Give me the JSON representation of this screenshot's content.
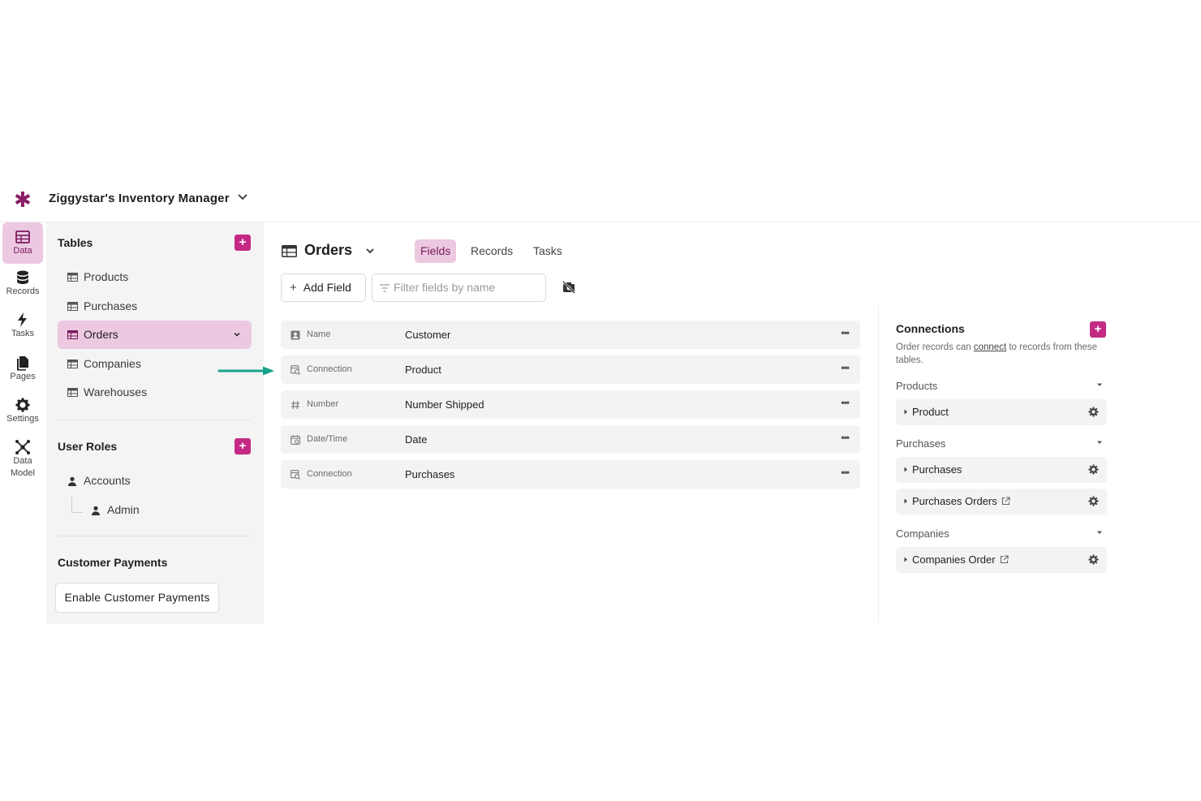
{
  "app": {
    "logo": "✱",
    "title": "Ziggystar's Inventory Manager"
  },
  "rail": [
    {
      "label": "Data",
      "icon": "data-table-icon",
      "active": true
    },
    {
      "label": "Records",
      "icon": "database-icon"
    },
    {
      "label": "Tasks",
      "icon": "lightning-icon"
    },
    {
      "label": "Pages",
      "icon": "pages-icon"
    },
    {
      "label": "Settings",
      "icon": "gear-icon"
    },
    {
      "label_line1": "Data",
      "label_line2": "Model",
      "icon": "data-model-icon"
    }
  ],
  "sidebar": {
    "tables_title": "Tables",
    "add_symbol": "+",
    "tables": [
      "Products",
      "Purchases",
      "Orders",
      "Companies",
      "Warehouses"
    ],
    "active_table": "Orders",
    "user_roles_title": "User Roles",
    "roles": [
      "Accounts",
      "Admin"
    ],
    "payments_title": "Customer Payments",
    "enable_payments_label": "Enable Customer Payments"
  },
  "main": {
    "title": "Orders",
    "tabs": [
      "Fields",
      "Records",
      "Tasks"
    ],
    "active_tab": "Fields",
    "add_field_label": "Add Field",
    "filter_placeholder": "Filter fields by name",
    "fields": [
      {
        "type": "Name",
        "icon": "name-field-icon",
        "name": "Customer"
      },
      {
        "type": "Connection",
        "icon": "connection-field-icon",
        "name": "Product"
      },
      {
        "type": "Number",
        "icon": "hash-icon",
        "name": "Number Shipped"
      },
      {
        "type": "Date/Time",
        "icon": "calendar-icon",
        "name": "Date"
      },
      {
        "type": "Connection",
        "icon": "connection-field-icon",
        "name": "Purchases"
      }
    ],
    "more_symbol": "•••"
  },
  "connections": {
    "title": "Connections",
    "desc_before": "Order records can ",
    "desc_link": "connect",
    "desc_after": " to records from these tables.",
    "groups": [
      {
        "label": "Products",
        "items": [
          {
            "label": "Product"
          }
        ]
      },
      {
        "label": "Purchases",
        "items": [
          {
            "label": "Purchases"
          },
          {
            "label": "Purchases Orders",
            "external": true
          }
        ]
      },
      {
        "label": "Companies",
        "items": [
          {
            "label": "Companies Order",
            "external": true
          }
        ]
      }
    ]
  },
  "colors": {
    "accent": "#c42a84",
    "active_bg": "#ecc9e1",
    "arrow": "#17a289",
    "logo": "#8a1e66"
  }
}
